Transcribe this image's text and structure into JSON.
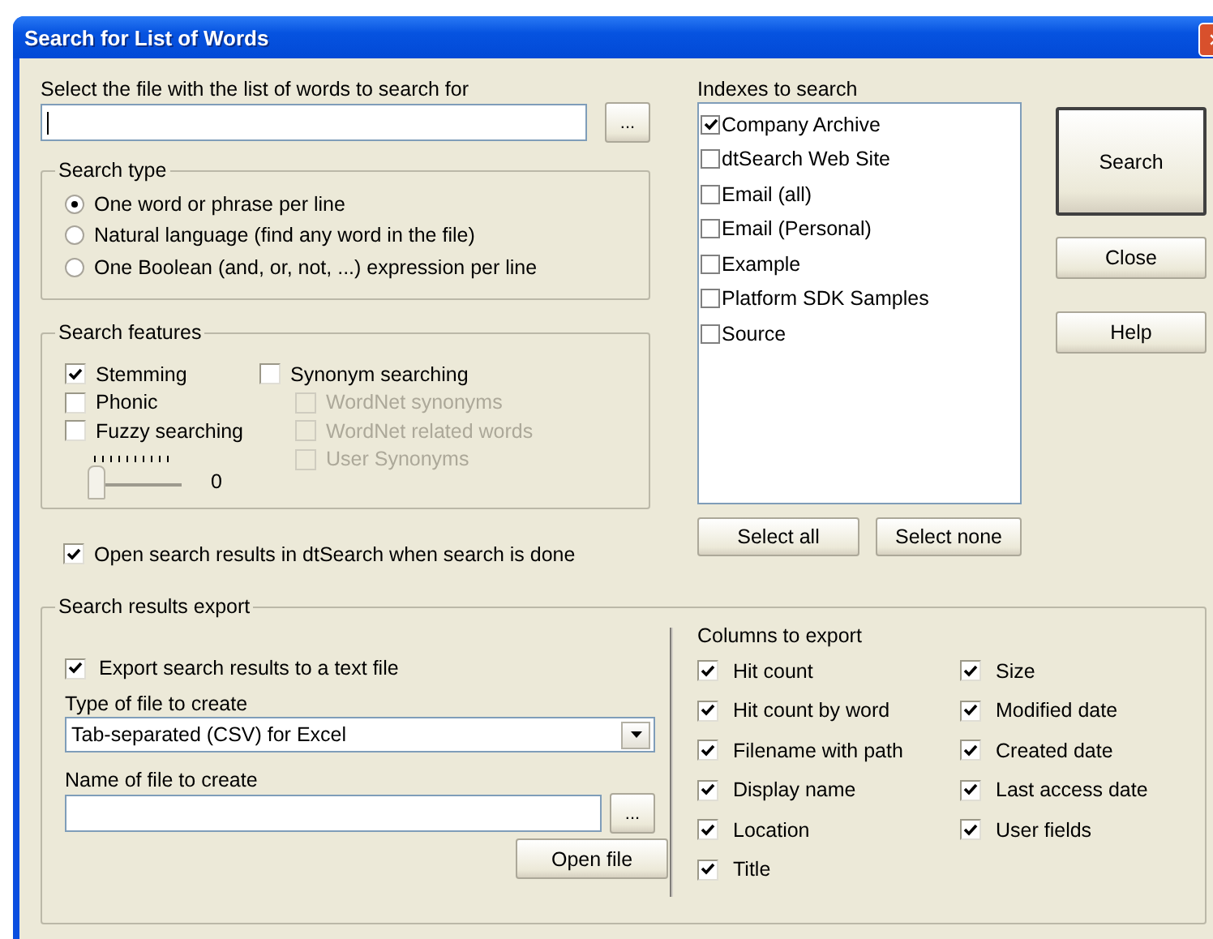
{
  "window": {
    "title": "Search for List of Words"
  },
  "word_file": {
    "label": "Select the file with the list of words to search for",
    "browse": "..."
  },
  "search_type": {
    "title": "Search type",
    "options": [
      {
        "label": "One word or phrase per line",
        "selected": true
      },
      {
        "label": "Natural language (find any word in the file)",
        "selected": false
      },
      {
        "label": "One Boolean (and, or, not, ...) expression per line",
        "selected": false
      }
    ]
  },
  "search_features": {
    "title": "Search features",
    "options": [
      {
        "label": "Stemming",
        "checked": true
      },
      {
        "label": "Phonic",
        "checked": false
      },
      {
        "label": "Fuzzy searching",
        "checked": false
      }
    ],
    "fuzziness": {
      "level": 0,
      "reading": "0"
    },
    "synonyms": [
      {
        "label": "Synonym searching",
        "checked": false,
        "disabled": false
      },
      {
        "label": "WordNet synonyms",
        "checked": false,
        "disabled": true
      },
      {
        "label": "WordNet related words",
        "checked": false,
        "disabled": true
      },
      {
        "label": "User Synonyms",
        "checked": false,
        "disabled": true
      }
    ]
  },
  "open_results": {
    "label": "Open search results in dtSearch when search is done",
    "checked": true
  },
  "indexes": {
    "label": "Indexes to search",
    "items": [
      {
        "label": "Company Archive",
        "checked": true
      },
      {
        "label": "dtSearch Web Site",
        "checked": false
      },
      {
        "label": "Email (all)",
        "checked": false
      },
      {
        "label": "Email (Personal)",
        "checked": false
      },
      {
        "label": "Example",
        "checked": false
      },
      {
        "label": "Platform SDK Samples",
        "checked": false
      },
      {
        "label": "Source",
        "checked": false
      }
    ],
    "select_all": "Select all",
    "select_none": "Select none"
  },
  "buttons": [
    {
      "label": "Search",
      "default": true
    },
    {
      "label": "Close",
      "default": false
    },
    {
      "label": "Help",
      "default": false
    }
  ],
  "export": {
    "title": "Search results export",
    "export_checkbox": {
      "label": "Export search results to a text file",
      "checked": true
    },
    "type_label": "Type of file to create",
    "type_value": "Tab-separated (CSV) for Excel",
    "name_label": "Name of file to create",
    "browse": "...",
    "open_file": "Open file",
    "columns_label": "Columns to export",
    "columns": [
      {
        "label": "Hit count",
        "checked": true
      },
      {
        "label": "Hit count by word",
        "checked": true
      },
      {
        "label": "Filename with path",
        "checked": true
      },
      {
        "label": "Display name",
        "checked": true
      },
      {
        "label": "Location",
        "checked": true
      },
      {
        "label": "Title",
        "checked": true
      },
      {
        "label": "Size",
        "checked": true
      },
      {
        "label": "Modified date",
        "checked": true
      },
      {
        "label": "Created date",
        "checked": true
      },
      {
        "label": "Last access date",
        "checked": true
      },
      {
        "label": "User fields",
        "checked": true
      }
    ]
  }
}
